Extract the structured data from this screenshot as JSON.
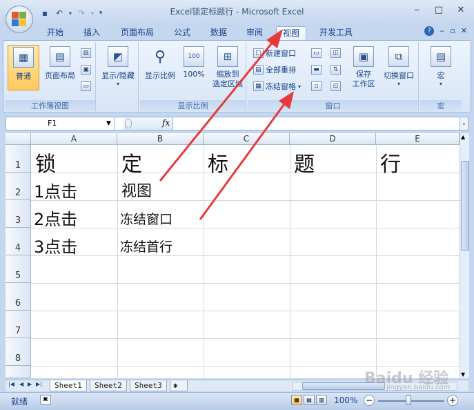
{
  "window": {
    "title": "Excel锁定标题行 - Microsoft Excel",
    "minimize": "‒",
    "maximize": "□",
    "close": "✕"
  },
  "qat": [
    "save-icon",
    "undo-icon",
    "redo-icon",
    "customize-icon"
  ],
  "tabs": [
    {
      "label": "开始",
      "active": false
    },
    {
      "label": "插入",
      "active": false
    },
    {
      "label": "页面布局",
      "active": false
    },
    {
      "label": "公式",
      "active": false
    },
    {
      "label": "数据",
      "active": false
    },
    {
      "label": "审阅",
      "active": false
    },
    {
      "label": "视图",
      "active": true
    },
    {
      "label": "开发工具",
      "active": false
    }
  ],
  "ribbon": {
    "workbook_views": {
      "label": "工作簿视图",
      "normal": "普通",
      "page_layout": "页面布局"
    },
    "show_hide": {
      "label": "显示/隐藏"
    },
    "zoom": {
      "label": "显示比例",
      "zoom": "显示比例",
      "zoom100": "100%",
      "zoom_selection_line1": "缩放到",
      "zoom_selection_line2": "选定区域"
    },
    "window": {
      "label": "窗口",
      "new_window": "新建窗口",
      "arrange_all": "全部重排",
      "freeze_panes": "冻结窗格",
      "save_workspace_line1": "保存",
      "save_workspace_line2": "工作区",
      "switch_windows": "切换窗口"
    },
    "macros": {
      "label": "宏",
      "macros": "宏"
    }
  },
  "formula_bar": {
    "name_box": "F1",
    "fx": "fx",
    "content": ""
  },
  "columns": [
    "A",
    "B",
    "C",
    "D",
    "E"
  ],
  "rows": [
    "1",
    "2",
    "3",
    "4",
    "5",
    "6",
    "7",
    "8"
  ],
  "cells": {
    "A1": "锁",
    "B1": "定",
    "C1": "标",
    "D1": "题",
    "E1": "行",
    "A2": "1点击",
    "B2": "视图",
    "A3": "2点击",
    "B3": "冻结窗口",
    "A4": "3点击",
    "B4": "冻结首行"
  },
  "sheet_tabs": [
    {
      "label": "Sheet1",
      "active": true
    },
    {
      "label": "Sheet2",
      "active": false
    },
    {
      "label": "Sheet3",
      "active": false
    }
  ],
  "status": {
    "ready": "就绪",
    "zoom": "100%"
  },
  "watermark": {
    "brand": "Baidu 经验",
    "url": "jingyan.baidu.com"
  },
  "colors": {
    "accent": "#15428b",
    "arrow": "#e8393a",
    "selected": "#ffc95c"
  }
}
